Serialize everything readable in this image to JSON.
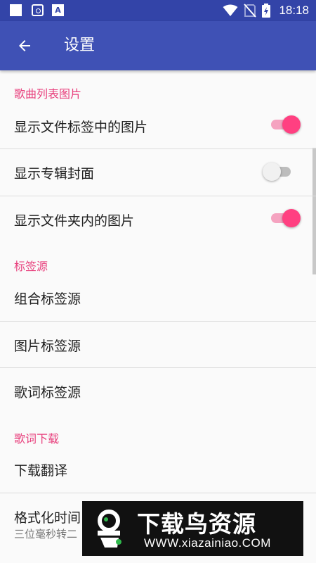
{
  "status_bar": {
    "time": "18:18",
    "icons": [
      "notification-square-icon",
      "shield-app-icon",
      "font-app-icon",
      "wifi-icon",
      "no-sim-icon",
      "battery-charging-icon"
    ]
  },
  "app_bar": {
    "title": "设置",
    "back_icon": "arrow-left-icon"
  },
  "colors": {
    "primary": "#3f51b5",
    "status_bar": "#3344a8",
    "accent": "#ff4081",
    "category_text": "#e8407d"
  },
  "sections": [
    {
      "header": "歌曲列表图片",
      "items": [
        {
          "label": "显示文件标签中的图片",
          "toggle": true
        },
        {
          "label": "显示专辑封面",
          "toggle": false
        },
        {
          "label": "显示文件夹内的图片",
          "toggle": true
        }
      ]
    },
    {
      "header": "标签源",
      "items": [
        {
          "label": "组合标签源"
        },
        {
          "label": "图片标签源"
        },
        {
          "label": "歌词标签源"
        }
      ]
    },
    {
      "header": "歌词下载",
      "items": [
        {
          "label": "下载翻译"
        },
        {
          "label": "格式化时间",
          "summary": "三位毫秒转二"
        }
      ]
    }
  ],
  "watermark": {
    "title": "下载鸟资源",
    "url": "WWW.xiazainiao.COM"
  }
}
